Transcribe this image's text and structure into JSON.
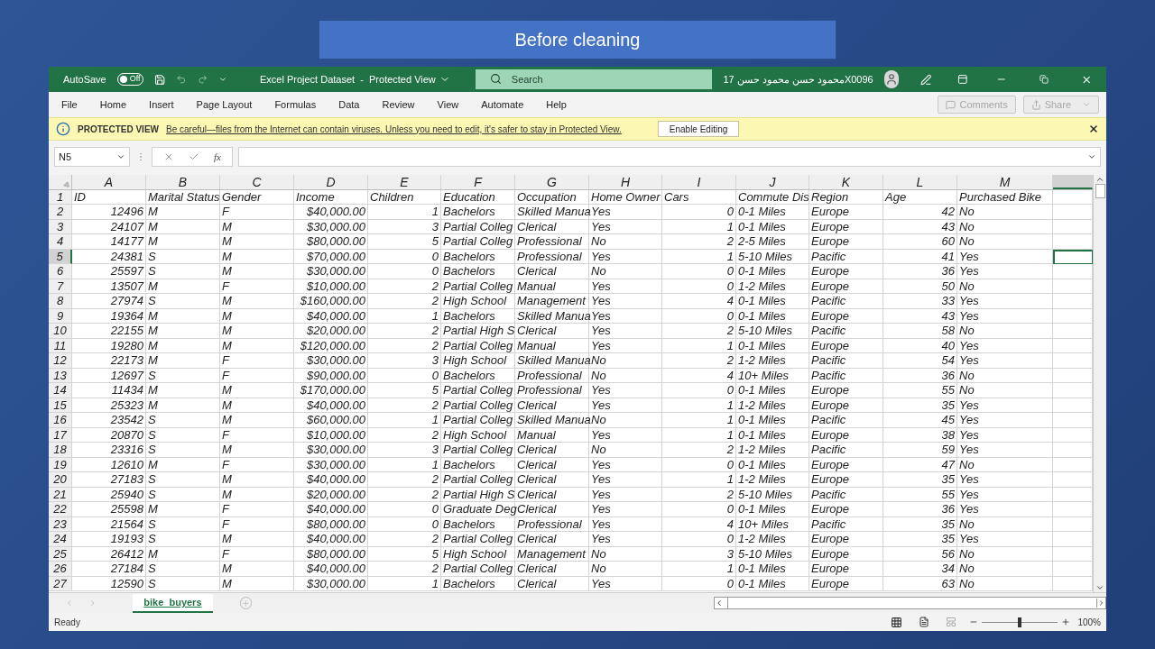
{
  "slide_title": "Before cleaning",
  "title_bar": {
    "autosave_label": "AutoSave",
    "autosave_toggle": {
      "label": "Off",
      "on": false
    },
    "document_title": "Excel Project Dataset  -  Protected View",
    "search": {
      "placeholder": "Search"
    },
    "user_name": "X0096محمود حسن محمود حسن 17"
  },
  "ribbon_tabs": [
    "File",
    "Home",
    "Insert",
    "Page Layout",
    "Formulas",
    "Data",
    "Review",
    "View",
    "Automate",
    "Help"
  ],
  "ribbon_buttons": [
    {
      "label": "Comments",
      "disabled": true
    },
    {
      "label": "Share",
      "disabled": true
    }
  ],
  "protected_view": {
    "title": "PROTECTED VIEW",
    "message": "Be careful—files from the Internet can contain viruses. Unless you need to edit, it's safer to stay in Protected View.",
    "button": "Enable Editing"
  },
  "formula_bar": {
    "name_box": "N5",
    "function_label": "fx"
  },
  "sheet": {
    "columns": [
      {
        "letter": "A",
        "kind": "number",
        "selected": false
      },
      {
        "letter": "B",
        "kind": "text",
        "selected": false
      },
      {
        "letter": "C",
        "kind": "text",
        "selected": false
      },
      {
        "letter": "D",
        "kind": "number",
        "selected": false
      },
      {
        "letter": "E",
        "kind": "number",
        "selected": false
      },
      {
        "letter": "F",
        "kind": "text",
        "selected": false
      },
      {
        "letter": "G",
        "kind": "text",
        "selected": false
      },
      {
        "letter": "H",
        "kind": "text",
        "selected": false
      },
      {
        "letter": "I",
        "kind": "number",
        "selected": false
      },
      {
        "letter": "J",
        "kind": "text",
        "selected": false
      },
      {
        "letter": "K",
        "kind": "text",
        "selected": false
      },
      {
        "letter": "L",
        "kind": "number",
        "selected": false
      },
      {
        "letter": "M",
        "kind": "text",
        "selected": false
      },
      {
        "kind": "text",
        "selected": true
      }
    ],
    "rows": [
      {
        "number": "1",
        "kind": "header",
        "selected": false,
        "cells": [
          "ID",
          "Marital Status",
          "Gender",
          "Income",
          "Children",
          "Education",
          "Occupation",
          "Home Owner",
          "Cars",
          "Commute Dis",
          "Region",
          "Age",
          "Purchased Bike"
        ]
      },
      {
        "number": "2",
        "kind": "data",
        "selected": false,
        "cells": [
          "12496",
          "M",
          "F",
          "$40,000.00",
          "1",
          "Bachelors",
          "Skilled Manua",
          "Yes",
          "0",
          "0-1 Miles",
          "Europe",
          "42",
          "No"
        ]
      },
      {
        "number": "3",
        "kind": "data",
        "selected": false,
        "cells": [
          "24107",
          "M",
          "M",
          "$30,000.00",
          "3",
          "Partial Colleg",
          "Clerical",
          "Yes",
          "1",
          "0-1 Miles",
          "Europe",
          "43",
          "No"
        ]
      },
      {
        "number": "4",
        "kind": "data",
        "selected": false,
        "cells": [
          "14177",
          "M",
          "M",
          "$80,000.00",
          "5",
          "Partial Colleg",
          "Professional",
          "No",
          "2",
          "2-5 Miles",
          "Europe",
          "60",
          "No"
        ]
      },
      {
        "number": "5",
        "kind": "data",
        "selected": true,
        "cells": [
          "24381",
          "S",
          "M",
          "$70,000.00",
          "0",
          "Bachelors",
          "Professional",
          "Yes",
          "1",
          "5-10 Miles",
          "Pacific",
          "41",
          "Yes"
        ]
      },
      {
        "number": "6",
        "kind": "data",
        "selected": false,
        "cells": [
          "25597",
          "S",
          "M",
          "$30,000.00",
          "0",
          "Bachelors",
          "Clerical",
          "No",
          "0",
          "0-1 Miles",
          "Europe",
          "36",
          "Yes"
        ]
      },
      {
        "number": "7",
        "kind": "data",
        "selected": false,
        "cells": [
          "13507",
          "M",
          "F",
          "$10,000.00",
          "2",
          "Partial Colleg",
          "Manual",
          "Yes",
          "0",
          "1-2 Miles",
          "Europe",
          "50",
          "No"
        ]
      },
      {
        "number": "8",
        "kind": "data",
        "selected": false,
        "cells": [
          "27974",
          "S",
          "M",
          "$160,000.00",
          "2",
          "High School",
          "Management",
          "Yes",
          "4",
          "0-1 Miles",
          "Pacific",
          "33",
          "Yes"
        ]
      },
      {
        "number": "9",
        "kind": "data",
        "selected": false,
        "cells": [
          "19364",
          "M",
          "M",
          "$40,000.00",
          "1",
          "Bachelors",
          "Skilled Manua",
          "Yes",
          "0",
          "0-1 Miles",
          "Europe",
          "43",
          "Yes"
        ]
      },
      {
        "number": "10",
        "kind": "data",
        "selected": false,
        "cells": [
          "22155",
          "M",
          "M",
          "$20,000.00",
          "2",
          "Partial High S",
          "Clerical",
          "Yes",
          "2",
          "5-10 Miles",
          "Pacific",
          "58",
          "No"
        ]
      },
      {
        "number": "11",
        "kind": "data",
        "selected": false,
        "cells": [
          "19280",
          "M",
          "M",
          "$120,000.00",
          "2",
          "Partial Colleg",
          "Manual",
          "Yes",
          "1",
          "0-1 Miles",
          "Europe",
          "40",
          "Yes"
        ]
      },
      {
        "number": "12",
        "kind": "data",
        "selected": false,
        "cells": [
          "22173",
          "M",
          "F",
          "$30,000.00",
          "3",
          "High School",
          "Skilled Manua",
          "No",
          "2",
          "1-2 Miles",
          "Pacific",
          "54",
          "Yes"
        ]
      },
      {
        "number": "13",
        "kind": "data",
        "selected": false,
        "cells": [
          "12697",
          "S",
          "F",
          "$90,000.00",
          "0",
          "Bachelors",
          "Professional",
          "No",
          "4",
          "10+ Miles",
          "Pacific",
          "36",
          "No"
        ]
      },
      {
        "number": "14",
        "kind": "data",
        "selected": false,
        "cells": [
          "11434",
          "M",
          "M",
          "$170,000.00",
          "5",
          "Partial Colleg",
          "Professional",
          "Yes",
          "0",
          "0-1 Miles",
          "Europe",
          "55",
          "No"
        ]
      },
      {
        "number": "15",
        "kind": "data",
        "selected": false,
        "cells": [
          "25323",
          "M",
          "M",
          "$40,000.00",
          "2",
          "Partial Colleg",
          "Clerical",
          "Yes",
          "1",
          "1-2 Miles",
          "Europe",
          "35",
          "Yes"
        ]
      },
      {
        "number": "16",
        "kind": "data",
        "selected": false,
        "cells": [
          "23542",
          "S",
          "M",
          "$60,000.00",
          "1",
          "Partial Colleg",
          "Skilled Manua",
          "No",
          "1",
          "0-1 Miles",
          "Pacific",
          "45",
          "Yes"
        ]
      },
      {
        "number": "17",
        "kind": "data",
        "selected": false,
        "cells": [
          "20870",
          "S",
          "F",
          "$10,000.00",
          "2",
          "High School",
          "Manual",
          "Yes",
          "1",
          "0-1 Miles",
          "Europe",
          "38",
          "Yes"
        ]
      },
      {
        "number": "18",
        "kind": "data",
        "selected": false,
        "cells": [
          "23316",
          "S",
          "M",
          "$30,000.00",
          "3",
          "Partial Colleg",
          "Clerical",
          "No",
          "2",
          "1-2 Miles",
          "Pacific",
          "59",
          "Yes"
        ]
      },
      {
        "number": "19",
        "kind": "data",
        "selected": false,
        "cells": [
          "12610",
          "M",
          "F",
          "$30,000.00",
          "1",
          "Bachelors",
          "Clerical",
          "Yes",
          "0",
          "0-1 Miles",
          "Europe",
          "47",
          "No"
        ]
      },
      {
        "number": "20",
        "kind": "data",
        "selected": false,
        "cells": [
          "27183",
          "S",
          "M",
          "$40,000.00",
          "2",
          "Partial Colleg",
          "Clerical",
          "Yes",
          "1",
          "1-2 Miles",
          "Europe",
          "35",
          "Yes"
        ]
      },
      {
        "number": "21",
        "kind": "data",
        "selected": false,
        "cells": [
          "25940",
          "S",
          "M",
          "$20,000.00",
          "2",
          "Partial High S",
          "Clerical",
          "Yes",
          "2",
          "5-10 Miles",
          "Pacific",
          "55",
          "Yes"
        ]
      },
      {
        "number": "22",
        "kind": "data",
        "selected": false,
        "cells": [
          "25598",
          "M",
          "F",
          "$40,000.00",
          "0",
          "Graduate Deg",
          "Clerical",
          "Yes",
          "0",
          "0-1 Miles",
          "Europe",
          "36",
          "Yes"
        ]
      },
      {
        "number": "23",
        "kind": "data",
        "selected": false,
        "cells": [
          "21564",
          "S",
          "F",
          "$80,000.00",
          "0",
          "Bachelors",
          "Professional",
          "Yes",
          "4",
          "10+ Miles",
          "Pacific",
          "35",
          "No"
        ]
      },
      {
        "number": "24",
        "kind": "data",
        "selected": false,
        "cells": [
          "19193",
          "S",
          "M",
          "$40,000.00",
          "2",
          "Partial Colleg",
          "Clerical",
          "Yes",
          "0",
          "1-2 Miles",
          "Europe",
          "35",
          "Yes"
        ]
      },
      {
        "number": "25",
        "kind": "data",
        "selected": false,
        "cells": [
          "26412",
          "M",
          "F",
          "$80,000.00",
          "5",
          "High School",
          "Management",
          "No",
          "3",
          "5-10 Miles",
          "Europe",
          "56",
          "No"
        ]
      },
      {
        "number": "26",
        "kind": "data",
        "selected": false,
        "cells": [
          "27184",
          "S",
          "M",
          "$40,000.00",
          "2",
          "Partial Colleg",
          "Clerical",
          "No",
          "1",
          "0-1 Miles",
          "Europe",
          "34",
          "No"
        ]
      },
      {
        "number": "27",
        "kind": "data",
        "selected": false,
        "cells": [
          "12590",
          "S",
          "M",
          "$30,000.00",
          "1",
          "Bachelors",
          "Clerical",
          "Yes",
          "0",
          "0-1 Miles",
          "Europe",
          "63",
          "No"
        ]
      }
    ]
  },
  "sheet_tabs": [
    {
      "label": "bike_buyers",
      "selected": true
    }
  ],
  "status_bar": {
    "status": "Ready",
    "zoom": {
      "level": 0.5
    },
    "zoom_text": "100%"
  }
}
